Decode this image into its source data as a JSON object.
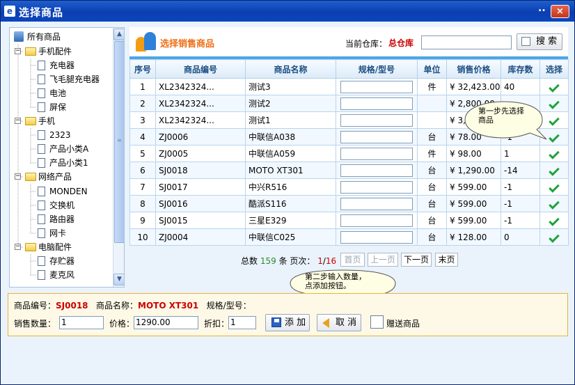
{
  "window": {
    "title": "选择商品",
    "dots": "..",
    "close": "×"
  },
  "tree": {
    "root": "所有商品",
    "groups": [
      {
        "label": "手机配件",
        "items": [
          "充电器",
          "飞毛腿充电器",
          "电池",
          "屏保"
        ]
      },
      {
        "label": "手机",
        "items": [
          "2323",
          "产品小类A",
          "产品小类1"
        ]
      },
      {
        "label": "网络产品",
        "items": [
          "MONDEN",
          "交换机",
          "路由器",
          "网卡"
        ]
      },
      {
        "label": "电脑配件",
        "items": [
          "存贮器",
          "麦克风"
        ]
      }
    ]
  },
  "header": {
    "title": "选择销售商品",
    "warehouse_label": "当前仓库：",
    "warehouse_value": "总仓库",
    "search_value": "",
    "search_button": "搜 索"
  },
  "table": {
    "columns": [
      "序号",
      "商品编号",
      "商品名称",
      "规格/型号",
      "单位",
      "销售价格",
      "库存数",
      "选择"
    ],
    "rows": [
      {
        "no": "1",
        "code": "XL2342324...",
        "name": "测试3",
        "spec": "",
        "unit": "件",
        "price": "¥ 32,423.00",
        "stock": "40"
      },
      {
        "no": "2",
        "code": "XL2342324...",
        "name": "测试2",
        "spec": "",
        "unit": "",
        "price": "¥ 2,800.00",
        "stock": ""
      },
      {
        "no": "3",
        "code": "XL2342324...",
        "name": "测试1",
        "spec": "",
        "unit": "",
        "price": "¥ 3,",
        "stock": ""
      },
      {
        "no": "4",
        "code": "ZJ0006",
        "name": "中联信A038",
        "spec": "",
        "unit": "台",
        "price": "¥ 78.00",
        "stock": "-1"
      },
      {
        "no": "5",
        "code": "ZJ0005",
        "name": "中联信A059",
        "spec": "",
        "unit": "件",
        "price": "¥ 98.00",
        "stock": "1"
      },
      {
        "no": "6",
        "code": "SJ0018",
        "name": "MOTO XT301",
        "spec": "",
        "unit": "台",
        "price": "¥ 1,290.00",
        "stock": "-14"
      },
      {
        "no": "7",
        "code": "SJ0017",
        "name": "中兴R516",
        "spec": "",
        "unit": "台",
        "price": "¥ 599.00",
        "stock": "-1"
      },
      {
        "no": "8",
        "code": "SJ0016",
        "name": "酷派S116",
        "spec": "",
        "unit": "台",
        "price": "¥ 599.00",
        "stock": "-1"
      },
      {
        "no": "9",
        "code": "SJ0015",
        "name": "三星E329",
        "spec": "",
        "unit": "台",
        "price": "¥ 599.00",
        "stock": "-1"
      },
      {
        "no": "10",
        "code": "ZJ0004",
        "name": "中联信C025",
        "spec": "",
        "unit": "台",
        "price": "¥ 128.00",
        "stock": "0"
      }
    ]
  },
  "pager": {
    "total_prefix": "总数",
    "total": "159",
    "total_suffix": "条 页次：",
    "page_current": "1",
    "page_sep": "/",
    "page_total": "16",
    "first": "首页",
    "prev": "上一页",
    "next": "下一页",
    "last": "末页"
  },
  "callouts": {
    "step1": "第一步先选择\n商品",
    "step2": "第二步输入数量，\n点添加按钮。"
  },
  "form": {
    "code_label": "商品编号：",
    "code_value": "SJ0018",
    "name_label": "商品名称：",
    "name_value": "MOTO XT301",
    "spec_label": "规格/型号：",
    "qty_label": "销售数量：",
    "qty_value": "1",
    "price_label": "价格：",
    "price_value": "1290.00",
    "discount_label": "折扣：",
    "discount_value": "1",
    "add_button": "添 加",
    "cancel_button": "取 消",
    "gift_label": "赠送商品",
    "gift_checked": false
  }
}
